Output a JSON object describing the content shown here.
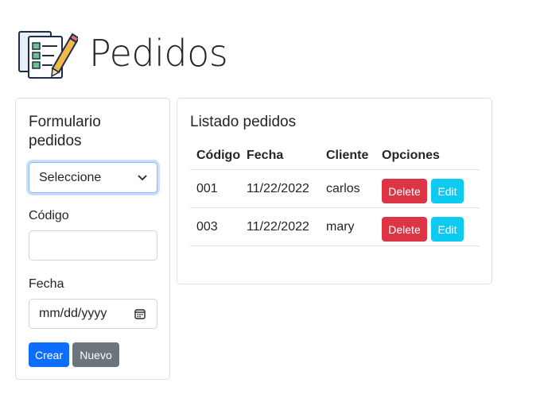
{
  "header": {
    "title": "Pedidos",
    "logo": "checklist-pencil-icon"
  },
  "form": {
    "title": "Formulario pedidos",
    "select_value": "Seleccione",
    "codigo_label": "Código",
    "codigo_value": "",
    "fecha_label": "Fecha",
    "fecha_placeholder": "mm/dd/yyyy",
    "crear_label": "Crear",
    "nuevo_label": "Nuevo"
  },
  "list": {
    "title": "Listado pedidos",
    "headers": [
      "Código",
      "Fecha",
      "Cliente",
      "Opciones"
    ],
    "rows": [
      {
        "codigo": "001",
        "fecha": "11/22/2022",
        "cliente": "carlos"
      },
      {
        "codigo": "003",
        "fecha": "11/22/2022",
        "cliente": "mary"
      }
    ],
    "delete_label": "Delete",
    "edit_label": "Edit"
  },
  "colors": {
    "primary": "#0d6efd",
    "secondary": "#6c757d",
    "danger": "#dc3545",
    "info": "#0dcaf0"
  }
}
